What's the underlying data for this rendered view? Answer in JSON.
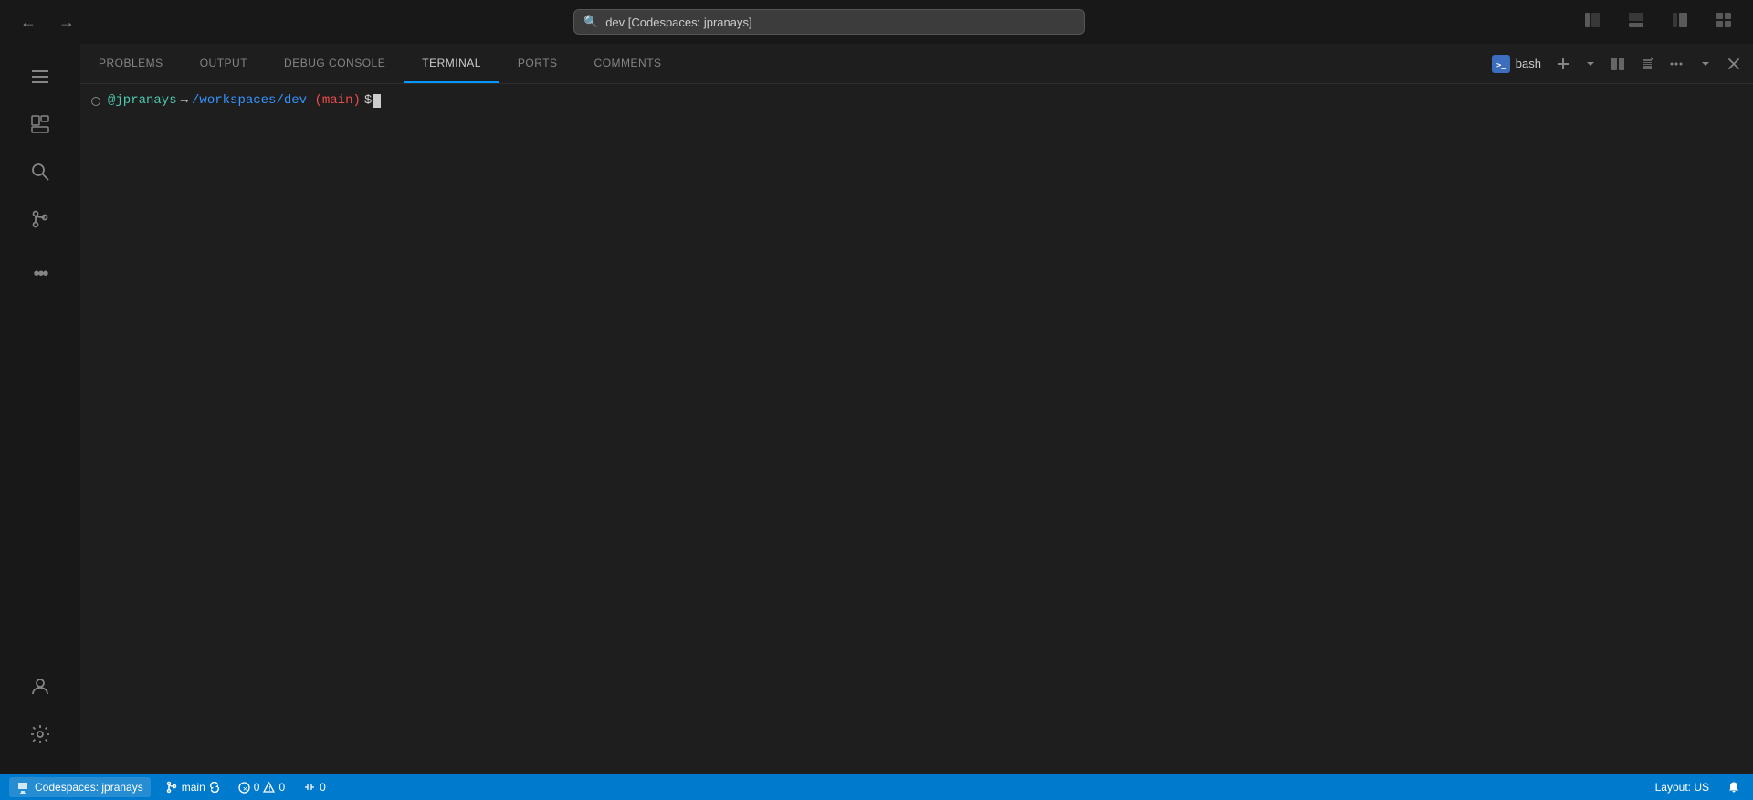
{
  "titleBar": {
    "searchText": "dev [Codespaces: jpranays]",
    "searchPlaceholder": "dev [Codespaces: jpranays]",
    "backBtn": "←",
    "forwardBtn": "→",
    "layoutIcon": "⊞",
    "menuIcon": "☰"
  },
  "activityBar": {
    "items": [
      {
        "id": "menu",
        "icon": "☰",
        "label": "Menu"
      },
      {
        "id": "explorer",
        "icon": "⧉",
        "label": "Explorer"
      },
      {
        "id": "search",
        "icon": "🔍",
        "label": "Search"
      },
      {
        "id": "git",
        "icon": "⎇",
        "label": "Source Control"
      },
      {
        "id": "extensions",
        "icon": "⋯",
        "label": "Extensions"
      }
    ],
    "bottomItems": [
      {
        "id": "account",
        "icon": "👤",
        "label": "Account"
      },
      {
        "id": "settings",
        "icon": "⚙",
        "label": "Settings"
      }
    ]
  },
  "panel": {
    "tabs": [
      {
        "id": "problems",
        "label": "PROBLEMS"
      },
      {
        "id": "output",
        "label": "OUTPUT"
      },
      {
        "id": "debug-console",
        "label": "DEBUG CONSOLE"
      },
      {
        "id": "terminal",
        "label": "TERMINAL",
        "active": true
      },
      {
        "id": "ports",
        "label": "PORTS"
      },
      {
        "id": "comments",
        "label": "COMMENTS"
      }
    ],
    "bashLabel": "bash",
    "addBtn": "+",
    "splitBtn": "⊟",
    "deleteBtn": "🗑",
    "moreBtn": "⋯",
    "collapseBtn": "∨",
    "closeBtn": "✕"
  },
  "terminal": {
    "promptDot": "○",
    "user": "@jpranays",
    "arrow": "→",
    "path": "/workspaces/dev",
    "branch": "(main)",
    "dollar": "$"
  },
  "statusBar": {
    "codespacesLabel": "Codespaces: jpranays",
    "branchLabel": "main",
    "errorsCount": "0",
    "warningsCount": "0",
    "portsCount": "0",
    "layoutLabel": "Layout: US",
    "bellIcon": "🔔"
  }
}
